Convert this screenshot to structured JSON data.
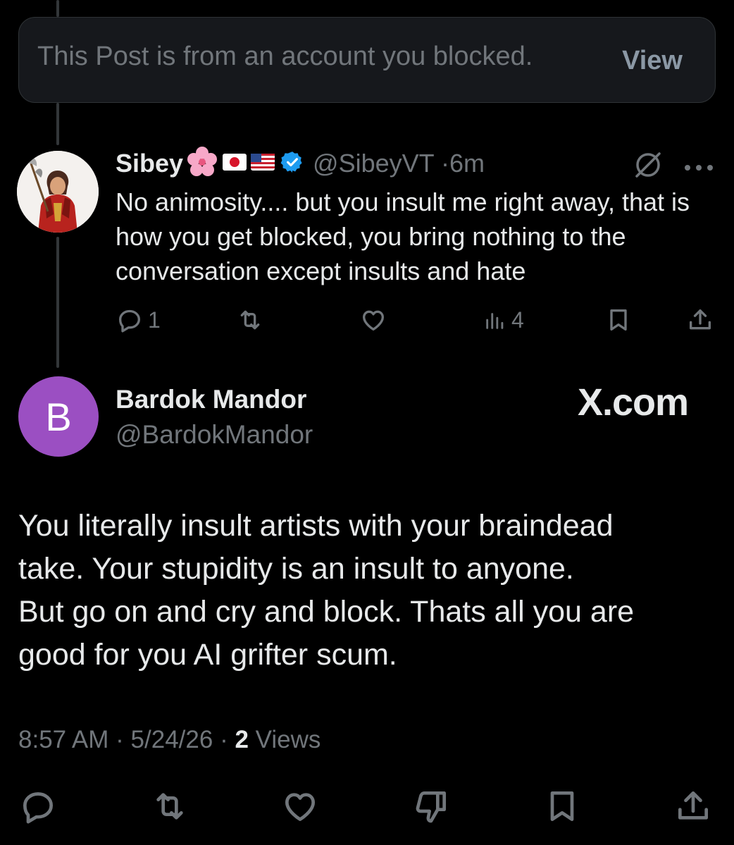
{
  "blocked_notice": {
    "text": "This Post is from an account you blocked.",
    "view_label": "View"
  },
  "reply": {
    "display_name": "Sibey",
    "name_emoji": "🌸",
    "flags": [
      "🇯🇵",
      "🇺🇸"
    ],
    "handle": "@SibeyVT",
    "separator": "·",
    "time": "6m",
    "text": "No animosity.... but you insult me right away, that is how you get blocked, you bring nothing to the conversation except insults and hate",
    "reply_count": "1",
    "view_count": "4"
  },
  "main_post": {
    "avatar_letter": "B",
    "display_name": "Bardok Mandor",
    "handle": "@BardokMandor",
    "text_lines": [
      "You literally insult artists with your braindead",
      "take. Your stupidity is an insult to anyone.",
      "But go on and cry and block. Thats all you are",
      "good for you AI grifter scum."
    ],
    "time": "8:57 AM",
    "date": "5/24/26",
    "separator": "·",
    "views_count": "2",
    "views_label": "Views"
  },
  "watermark": "X.com",
  "colors": {
    "background": "#000000",
    "text_primary": "#e7e9ea",
    "text_secondary": "#71767b",
    "verified_blue": "#1d9bf0",
    "avatar_purple": "#9b4fc2"
  },
  "icons": [
    "reply-icon",
    "repost-icon",
    "like-icon",
    "views-icon",
    "bookmark-icon",
    "share-icon",
    "dislike-icon",
    "grok-icon",
    "more-icon",
    "verified-icon"
  ]
}
